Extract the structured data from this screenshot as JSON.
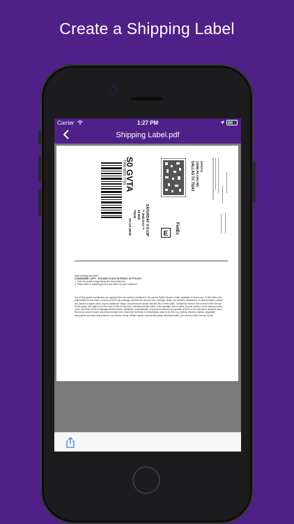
{
  "headline": "Create a Shipping Label",
  "status": {
    "carrier": "Carrier",
    "time": "1:27 PM"
  },
  "nav": {
    "title": "Shipping Label.pdf"
  },
  "label": {
    "code": "S0 GVTA",
    "tracking": "7968 5603 7793",
    "delivery_day": "SATURDAY X 6-13P",
    "delivery_line2": "** 2ND DAY **",
    "delivery_line3": "38 E88",
    "route": "75243",
    "origin": "TX-US DFW",
    "city_line": "DALLAS TX 75243",
    "street": "12086 PLANO RD",
    "recipient": "SAGAS"
  },
  "instructions": {
    "line1": "After printing this label:",
    "line2": "CONSIGNEE COPY - PLEASE PLACE IN FRONT OF POUCH",
    "line3": "1. Fold the printed page along the horizontal line.",
    "line4": "2. Place label in shipping pouch and affix it to your shipment."
  },
  "terms": "Use of this system constitutes your agreement to the service conditions in the current FedEx Service Guide, available on fedex.com. FedEx will not be responsible for any claim in excess of $100 per package, whether the result of loss, damage, delay, non-delivery, misdelivery, or misinformation, unless you declare a higher value, pay an additional charge, document your actual loss and file a timely claim. Limitations found in the current FedEx Service Guide apply. Your right to recover from FedEx for any loss, including intrinsic value of the package, loss of sales, income interest, profit, attorney's fees, costs, and other forms of damage whether direct, incidental, consequential, or special is limited to the greater of $100 or the authorized declared value. Recovery cannot exceed actual documented loss. Maximum for items of extraordinary value is $1,000, e.g. jewelry, precious metals, negotiable instruments and other items listed in our Service Guide. Written claims must be filed within strict time limits, see current FedEx Service Guide.",
  "icons": {
    "back": "chevron-left-icon",
    "share": "share-icon",
    "wifi": "wifi-icon",
    "location": "location-icon",
    "battery": "battery-icon"
  },
  "colors": {
    "brand": "#4f2088",
    "battery": "#4cd964",
    "share": "#2f7ee8"
  }
}
